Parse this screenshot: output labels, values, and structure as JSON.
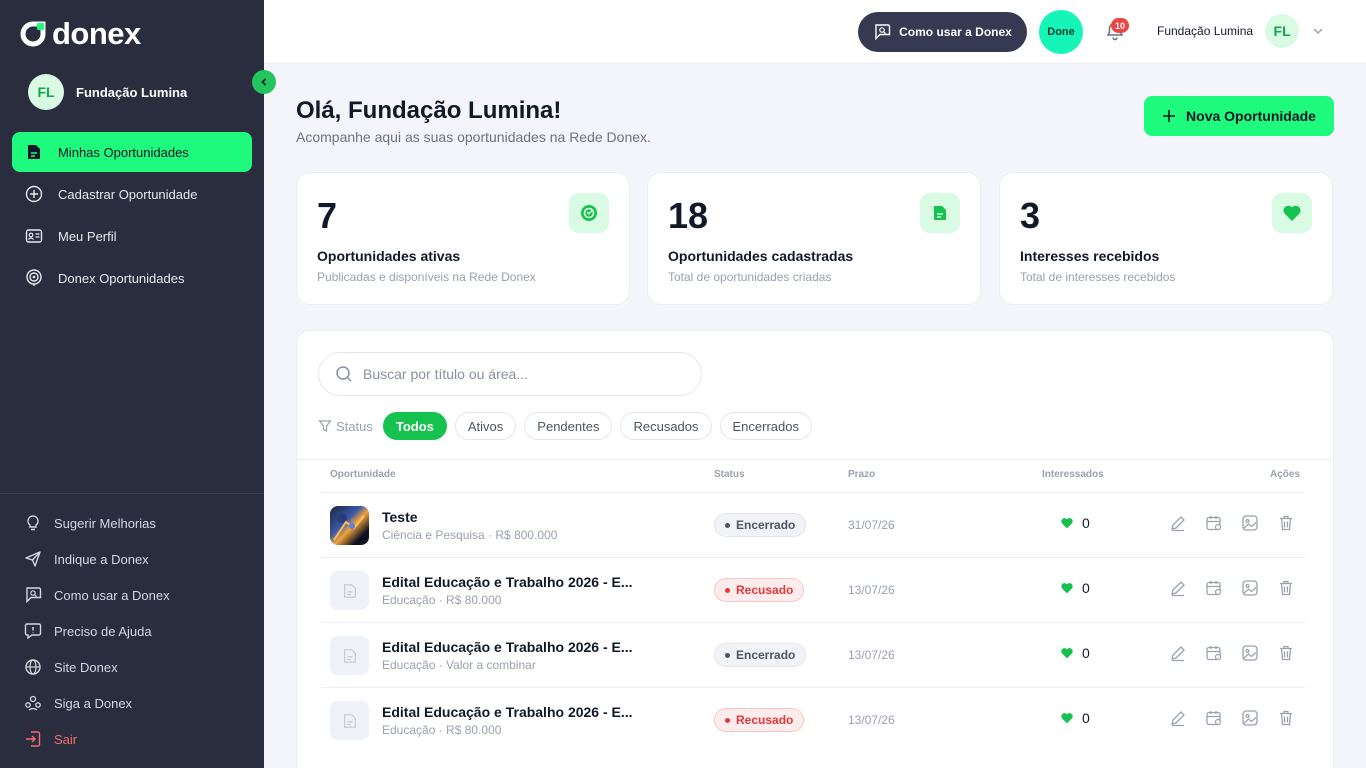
{
  "brand": {
    "name": "donex",
    "accent": "#1dfa7c",
    "sidebar_bg": "#2a2d3e"
  },
  "sidebar": {
    "user": {
      "initials": "FL",
      "name": "Fundação Lumina"
    },
    "nav": [
      {
        "label": "Minhas Oportunidades",
        "icon": "document-icon",
        "active": true
      },
      {
        "label": "Cadastrar Oportunidade",
        "icon": "plus-circle-icon",
        "active": false
      },
      {
        "label": "Meu Perfil",
        "icon": "id-card-icon",
        "active": false
      },
      {
        "label": "Donex Oportunidades",
        "icon": "radar-icon",
        "active": false
      }
    ],
    "bottom": [
      {
        "label": "Sugerir Melhorias",
        "icon": "lightbulb-icon"
      },
      {
        "label": "Indique a Donex",
        "icon": "send-icon"
      },
      {
        "label": "Como usar a Donex",
        "icon": "chat-search-icon"
      },
      {
        "label": "Preciso de Ajuda",
        "icon": "help-chat-icon"
      },
      {
        "label": "Site Donex",
        "icon": "globe-icon"
      },
      {
        "label": "Siga a Donex",
        "icon": "community-icon"
      },
      {
        "label": "Sair",
        "icon": "logout-icon"
      }
    ]
  },
  "topbar": {
    "how_to_label": "Como usar a Donex",
    "assistant_label": "Done",
    "notifications_count": "10",
    "user_name": "Fundação Lumina",
    "user_initials": "FL"
  },
  "header": {
    "greeting": "Olá, Fundação Lumina!",
    "subtitle": "Acompanhe aqui as suas oportunidades na Rede Donex.",
    "new_button": "Nova Oportunidade"
  },
  "stats": [
    {
      "value": "7",
      "title": "Oportunidades ativas",
      "desc": "Publicadas e disponíveis na Rede Donex",
      "icon": "active-circle-icon"
    },
    {
      "value": "18",
      "title": "Oportunidades cadastradas",
      "desc": "Total de oportunidades criadas",
      "icon": "document-icon"
    },
    {
      "value": "3",
      "title": "Interesses recebidos",
      "desc": "Total de interesses recebidos",
      "icon": "heart-icon"
    }
  ],
  "search": {
    "placeholder": "Buscar por título ou área..."
  },
  "filters": {
    "label": "Status",
    "options": [
      "Todos",
      "Ativos",
      "Pendentes",
      "Recusados",
      "Encerrados"
    ],
    "selected": "Todos"
  },
  "table": {
    "columns": [
      "Oportunidade",
      "Status",
      "Prazo",
      "Interessados",
      "Ações"
    ],
    "rows": [
      {
        "title": "Teste",
        "subtitle": "Ciência e Pesquisa · R$ 800.000",
        "status": "Encerrado",
        "deadline": "31/07/26",
        "interested": "0",
        "thumb": "photo"
      },
      {
        "title": "Edital Educação e Trabalho 2026 - E...",
        "subtitle": "Educação · R$ 80.000",
        "status": "Recusado",
        "deadline": "13/07/26",
        "interested": "0",
        "thumb": "doc"
      },
      {
        "title": "Edital Educação e Trabalho 2026 - E...",
        "subtitle": "Educação · Valor a combinar",
        "status": "Encerrado",
        "deadline": "13/07/26",
        "interested": "0",
        "thumb": "doc"
      },
      {
        "title": "Edital Educação e Trabalho 2026 - E...",
        "subtitle": "Educação · R$ 80.000",
        "status": "Recusado",
        "deadline": "13/07/26",
        "interested": "0",
        "thumb": "doc"
      }
    ]
  }
}
